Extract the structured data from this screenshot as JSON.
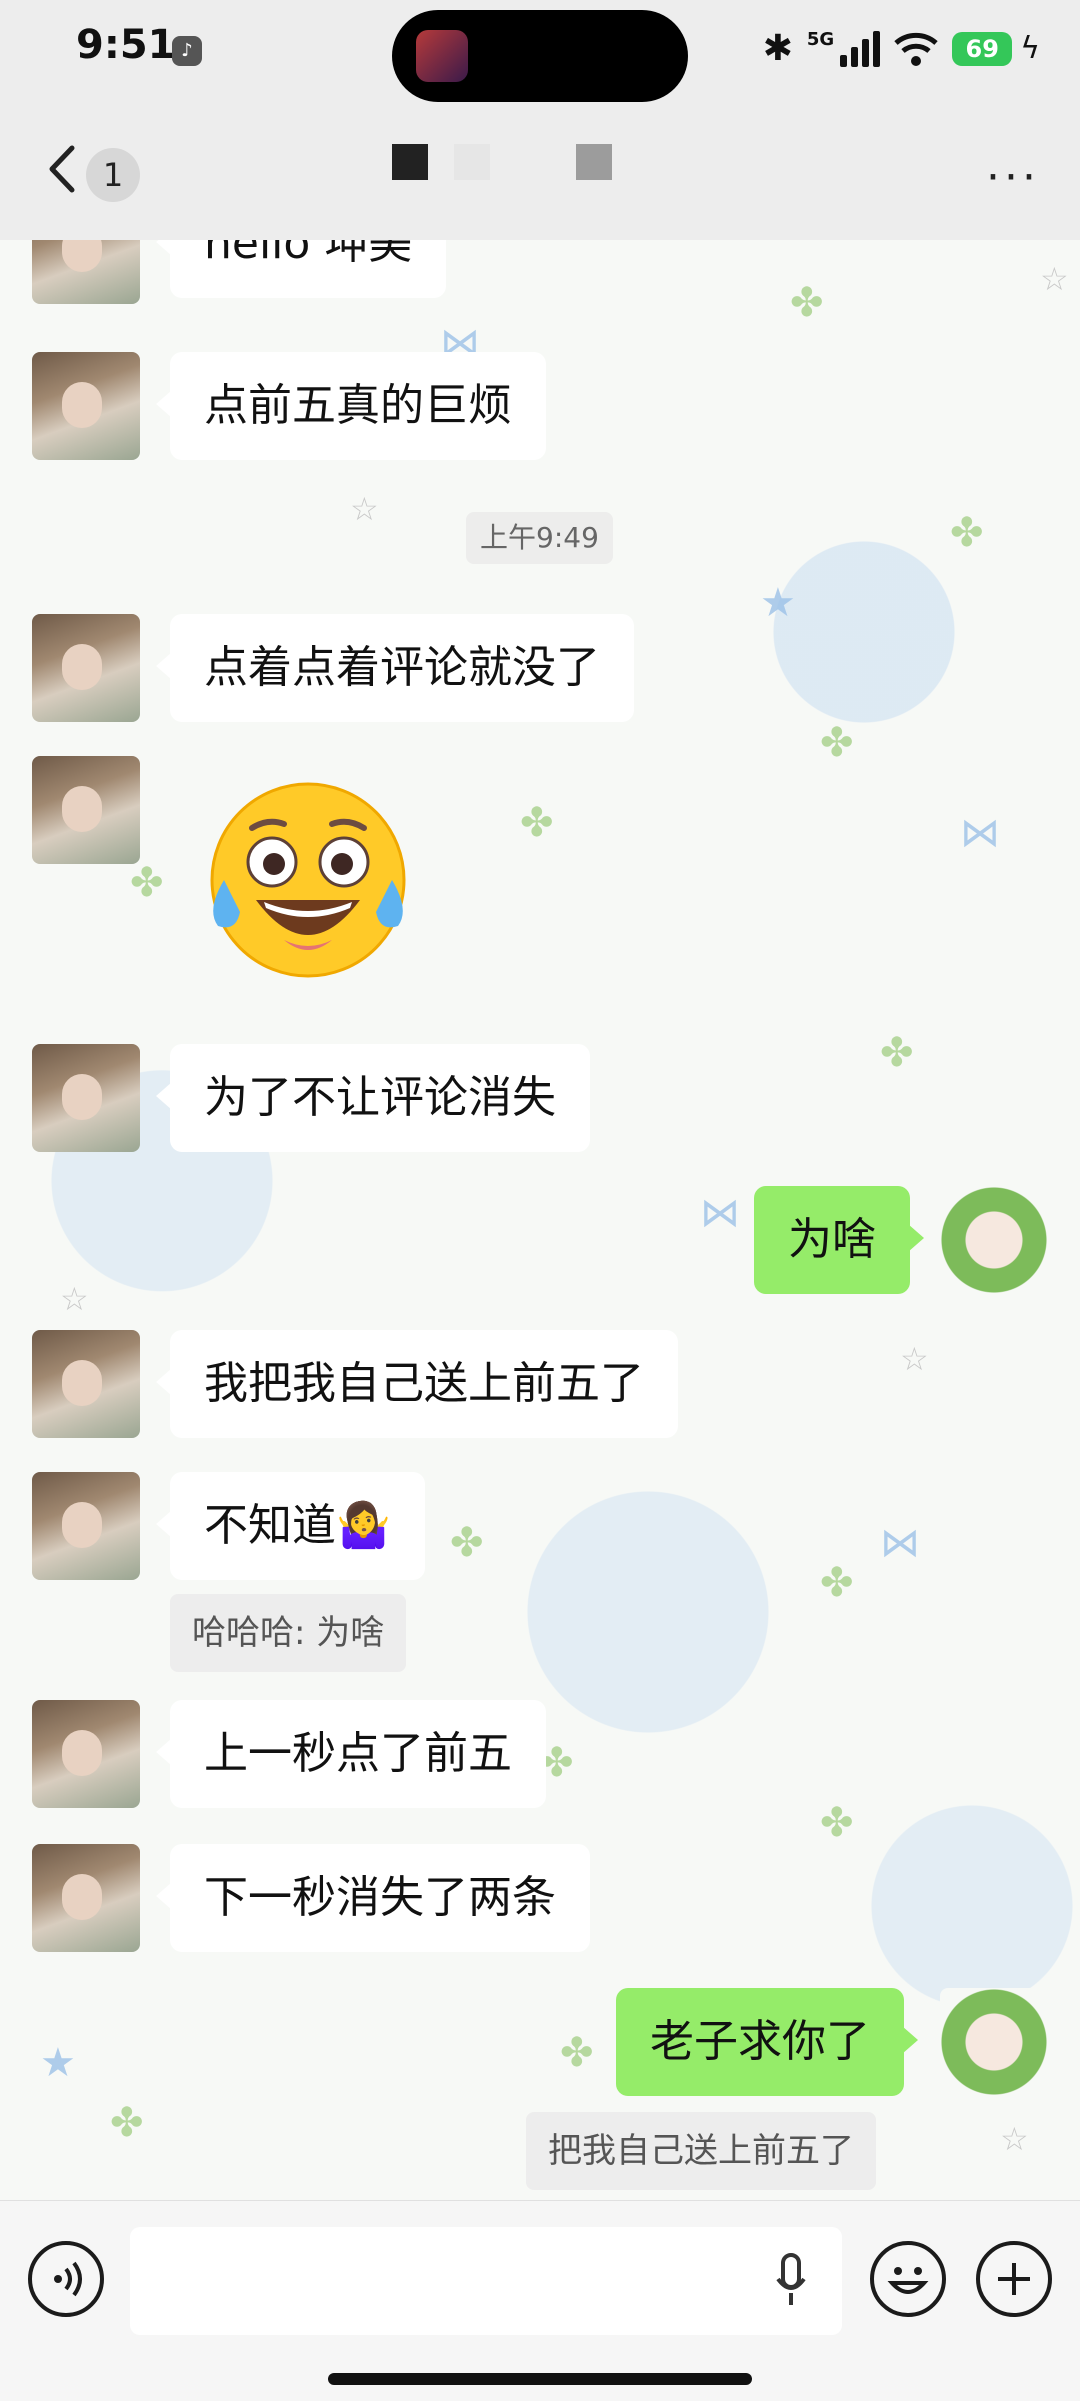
{
  "status_bar": {
    "time": "9:51",
    "network": "5G",
    "battery": "69"
  },
  "header": {
    "unread_count": "1",
    "more_label": "···"
  },
  "chat": {
    "timestamp": "上午9:49",
    "messages": [
      {
        "side": "left",
        "text": "hello 坤美"
      },
      {
        "side": "left",
        "text": "点前五真的巨烦"
      },
      {
        "side": "left",
        "text": "点着点着评论就没了"
      },
      {
        "side": "left",
        "type": "emoji",
        "text": "😂",
        "emoji_name": "crying-laughing-face"
      },
      {
        "side": "left",
        "text": "为了不让评论消失"
      },
      {
        "side": "right",
        "text": "为啥"
      },
      {
        "side": "left",
        "text": "我把我自己送上前五了"
      },
      {
        "side": "left",
        "text": "不知道🤷‍♀️",
        "quote": "哈哈哈: 为啥"
      },
      {
        "side": "left",
        "text": "上一秒点了前五"
      },
      {
        "side": "left",
        "text": "下一秒消失了两条"
      },
      {
        "side": "right",
        "text": "老子求你了",
        "quote": "把我自己送上前五了"
      }
    ]
  },
  "input_bar": {
    "text": "",
    "icons": [
      "voice-icon",
      "mic-icon",
      "emoji-icon",
      "plus-icon"
    ]
  },
  "colors": {
    "bubble_green": "#95ec69",
    "bubble_white": "#ffffff",
    "bar_gray": "#ededed"
  }
}
